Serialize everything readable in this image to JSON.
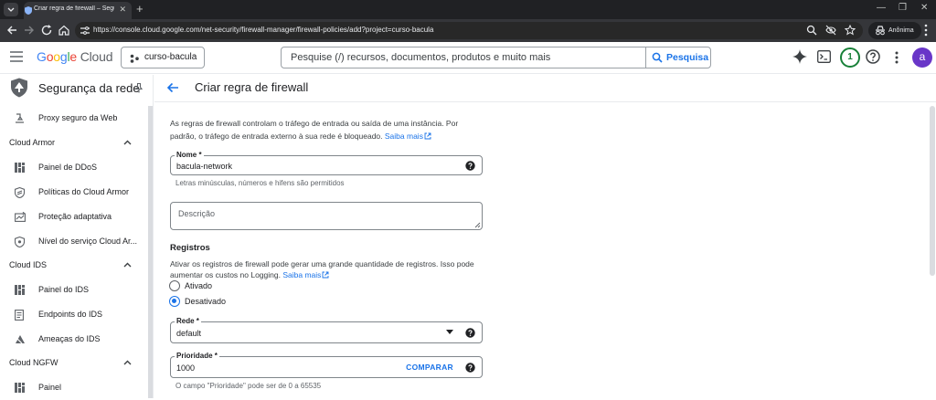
{
  "browser": {
    "tab_title": "Criar regra de firewall – Segurança",
    "url": "https://console.cloud.google.com/net-security/firewall-manager/firewall-policies/add?project=curso-bacula",
    "incognito_label": "Anônima"
  },
  "header": {
    "logo_google": "Google",
    "logo_cloud": "Cloud",
    "project": "curso-bacula",
    "search_placeholder": "Pesquise (/) recursos, documentos, produtos e muito mais",
    "search_button": "Pesquisa",
    "notification_count": "1",
    "avatar_letter": "a"
  },
  "sidebar": {
    "title": "Segurança da rede",
    "proxy": "Proxy seguro da Web",
    "armor_section": "Cloud Armor",
    "armor_items": [
      "Painel de DDoS",
      "Políticas do Cloud Armor",
      "Proteção adaptativa",
      "Nível do serviço Cloud Ar..."
    ],
    "ids_section": "Cloud IDS",
    "ids_items": [
      "Painel do IDS",
      "Endpoints do IDS",
      "Ameaças do IDS"
    ],
    "ngfw_section": "Cloud NGFW",
    "ngfw_items": [
      "Painel"
    ]
  },
  "page": {
    "title": "Criar regra de firewall",
    "intro": "As regras de firewall controlam o tráfego de entrada ou saída de uma instância. Por padrão, o tráfego de entrada externo à sua rede é bloqueado.",
    "intro_link": "Saiba mais",
    "name_label": "Nome *",
    "name_value": "bacula-network",
    "name_hint": "Letras minúsculas, números e hifens são permitidos",
    "description_placeholder": "Descrição",
    "logs_title": "Registros",
    "logs_desc": "Ativar os registros de firewall pode gerar uma grande quantidade de registros. Isso pode aumentar os custos no Logging.",
    "logs_link": "Saiba mais",
    "radio_on_label": "Ativado",
    "radio_off_label": "Desativado",
    "logs_selected": "Desativado",
    "network_label": "Rede *",
    "network_value": "default",
    "priority_label": "Prioridade *",
    "priority_value": "1000",
    "compare_label": "COMPARAR",
    "priority_hint": "O campo \"Prioridade\" pode ser de 0 a 65535"
  },
  "colors": {
    "accent": "#1a73e8",
    "notification": "#188038",
    "avatar": "#6936c8"
  }
}
